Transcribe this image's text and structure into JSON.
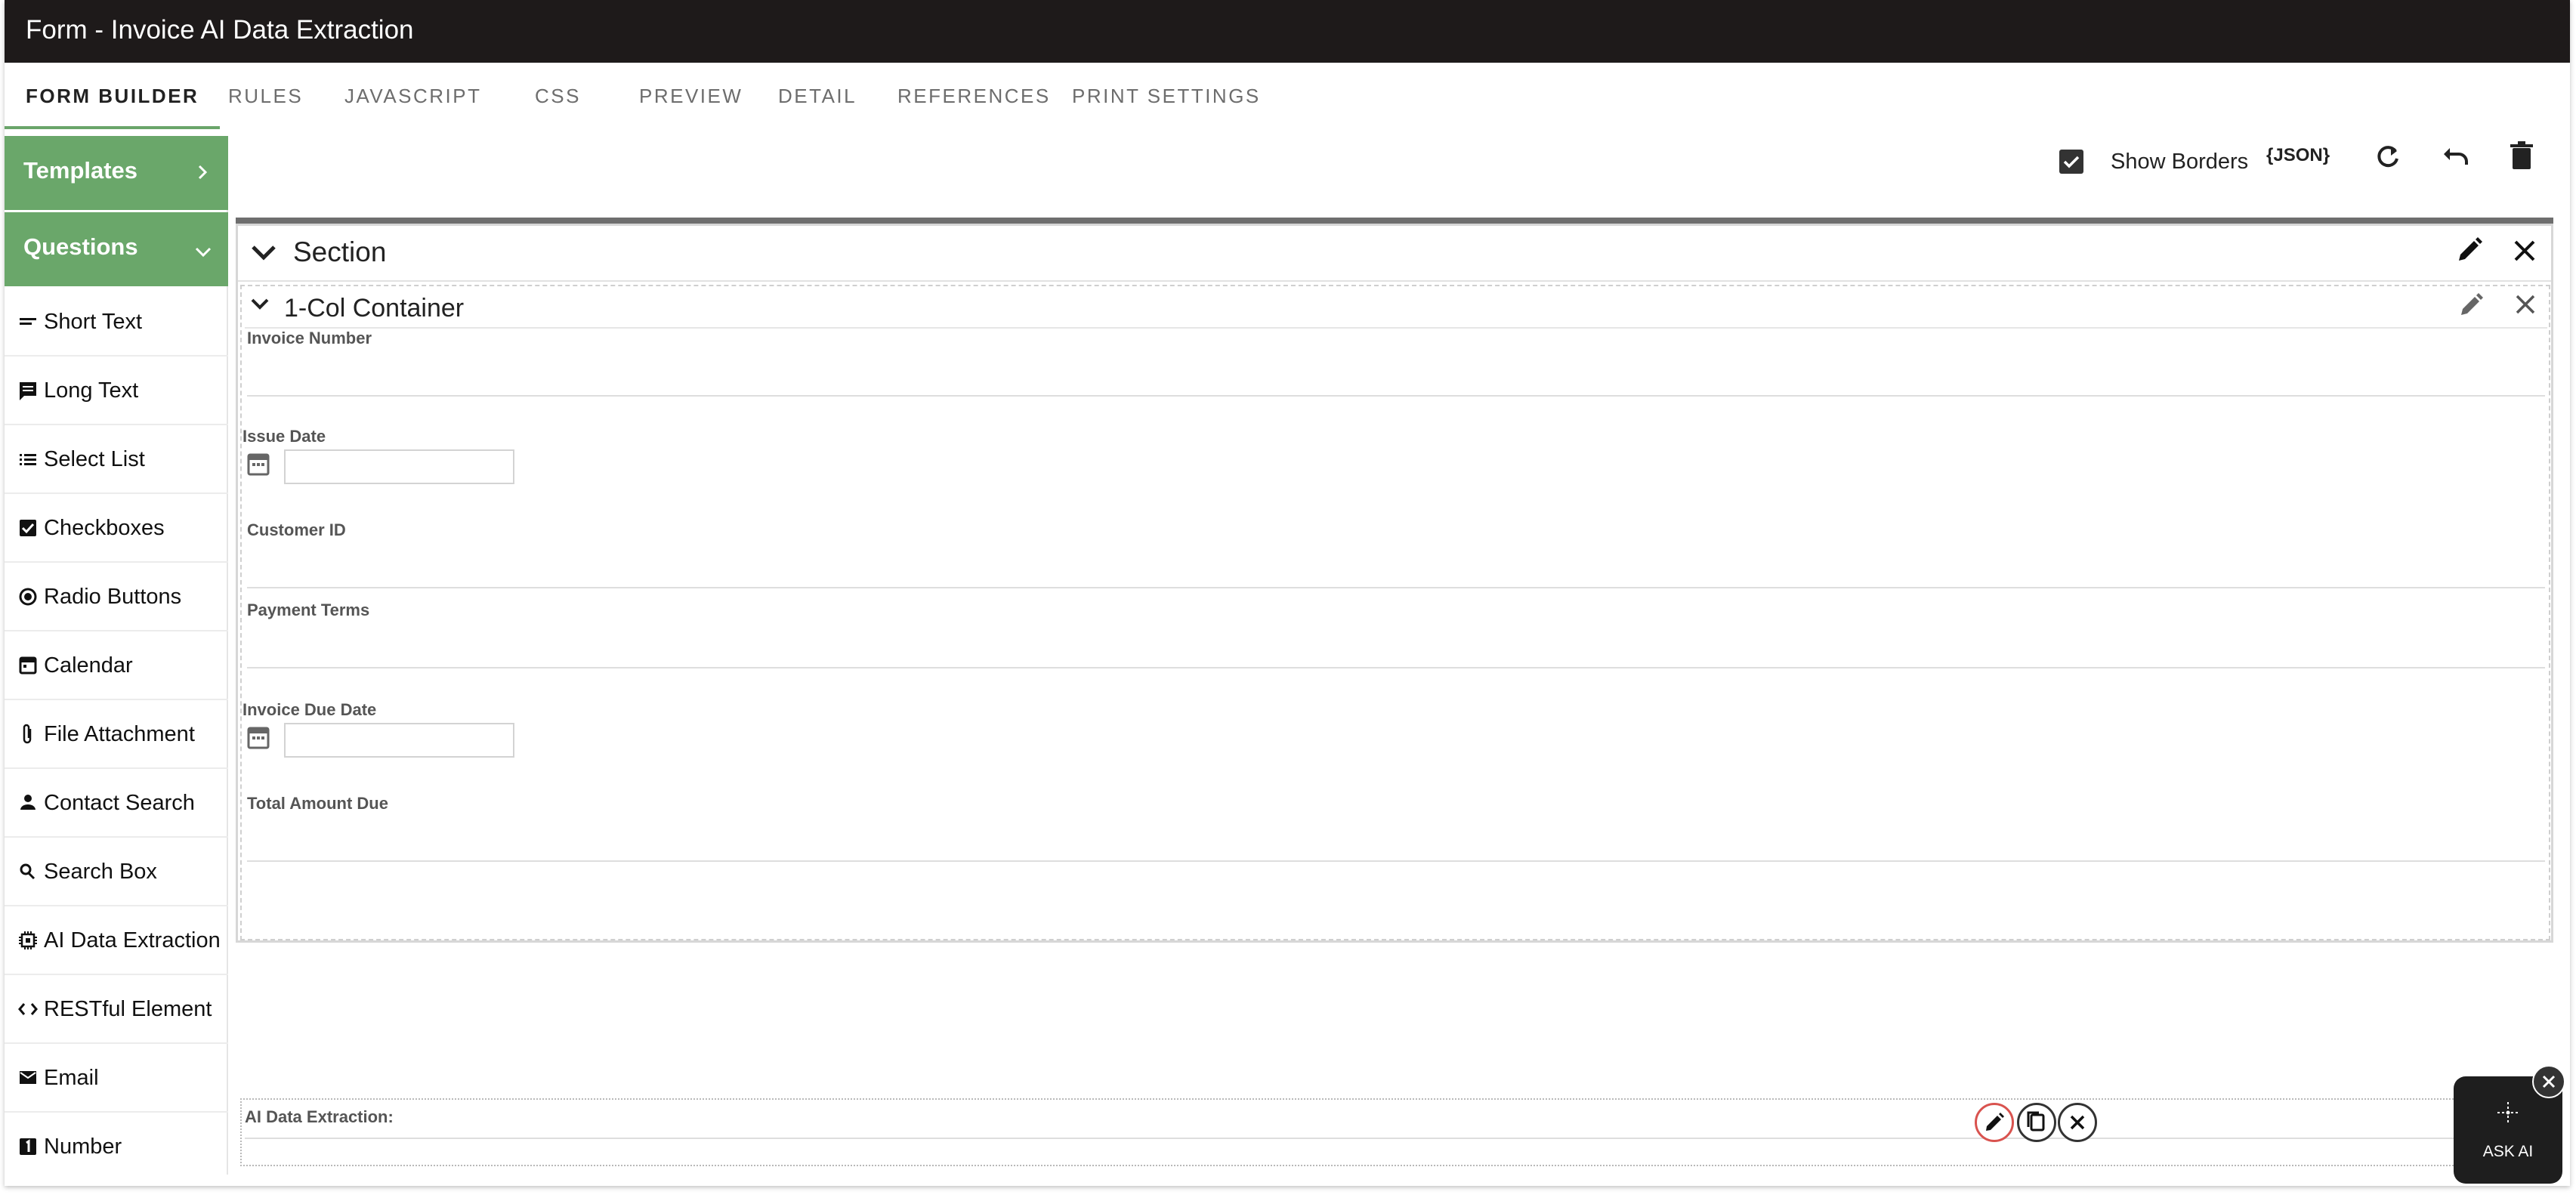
{
  "window": {
    "title": "Form - Invoice AI Data Extraction"
  },
  "tabs": [
    {
      "label": "FORM BUILDER",
      "active": true
    },
    {
      "label": "RULES"
    },
    {
      "label": "JAVASCRIPT"
    },
    {
      "label": "CSS"
    },
    {
      "label": "PREVIEW"
    },
    {
      "label": "DETAIL"
    },
    {
      "label": "REFERENCES"
    },
    {
      "label": "PRINT SETTINGS"
    }
  ],
  "sidebar": {
    "templates_label": "Templates",
    "questions_label": "Questions",
    "items": [
      {
        "label": "Short Text",
        "icon": "short-text-icon"
      },
      {
        "label": "Long Text",
        "icon": "comment-icon"
      },
      {
        "label": "Select List",
        "icon": "list-icon"
      },
      {
        "label": "Checkboxes",
        "icon": "checkbox-icon"
      },
      {
        "label": "Radio Buttons",
        "icon": "radio-icon"
      },
      {
        "label": "Calendar",
        "icon": "calendar-icon"
      },
      {
        "label": "File Attachment",
        "icon": "paperclip-icon"
      },
      {
        "label": "Contact Search",
        "icon": "person-icon"
      },
      {
        "label": "Search Box",
        "icon": "search-icon"
      },
      {
        "label": "AI Data Extraction",
        "icon": "chip-icon"
      },
      {
        "label": "RESTful Element",
        "icon": "code-icon"
      },
      {
        "label": "Email",
        "icon": "mail-icon"
      },
      {
        "label": "Number",
        "icon": "number-icon"
      }
    ]
  },
  "toolbar": {
    "show_borders_label": "Show Borders",
    "show_borders_checked": true,
    "json_label": "{JSON}"
  },
  "section": {
    "title": "Section",
    "container_title": "1-Col Container",
    "fields": {
      "invoice_number": "Invoice Number",
      "issue_date": "Issue Date",
      "customer_id": "Customer ID",
      "payment_terms": "Payment Terms",
      "invoice_due_date": "Invoice Due Date",
      "total_amount_due": "Total Amount Due",
      "ai_data_extraction": "AI Data Extraction:"
    }
  },
  "ask_ai": {
    "label": "ASK AI"
  },
  "colors": {
    "accent": "#6aa76a",
    "titlebar": "#1e1a1a"
  }
}
